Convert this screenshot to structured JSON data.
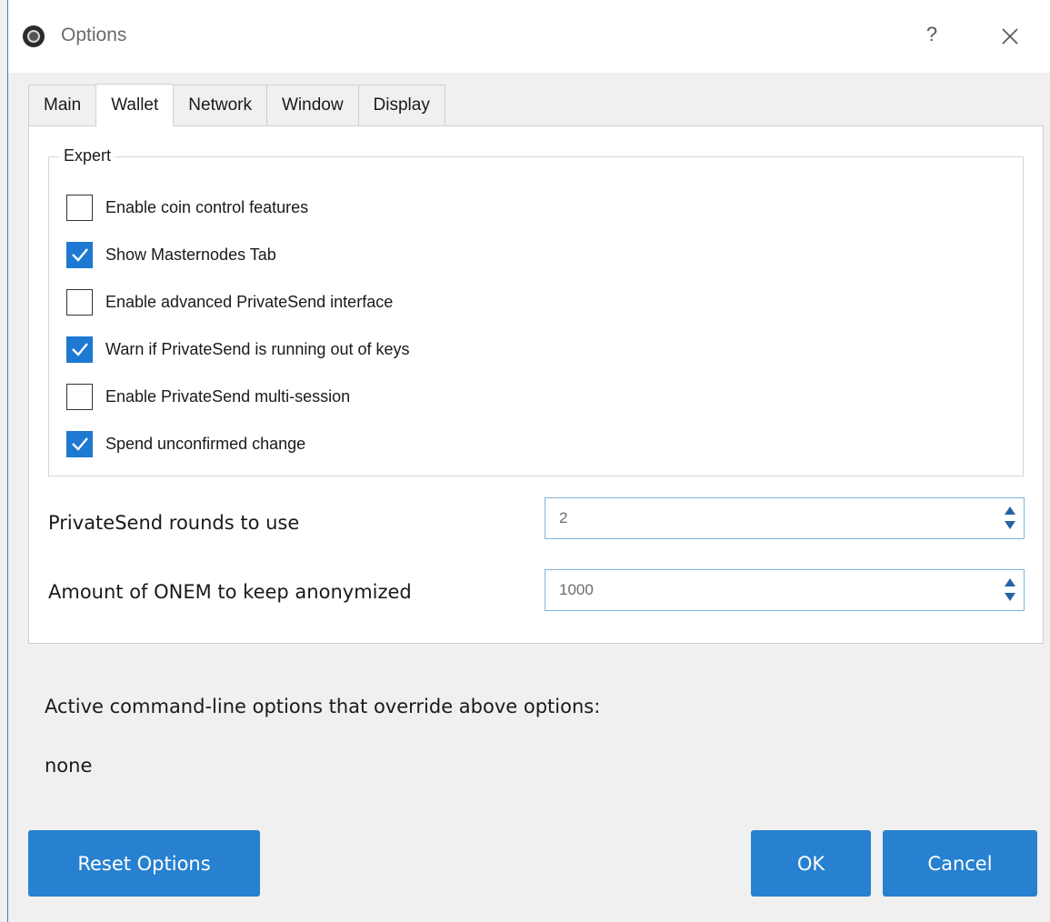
{
  "window": {
    "title": "Options",
    "help_label": "?",
    "icons": {
      "app": "app-logo-icon",
      "close": "close-icon"
    }
  },
  "tabs": [
    {
      "label": "Main",
      "active": false
    },
    {
      "label": "Wallet",
      "active": true
    },
    {
      "label": "Network",
      "active": false
    },
    {
      "label": "Window",
      "active": false
    },
    {
      "label": "Display",
      "active": false
    }
  ],
  "expert": {
    "title": "Expert",
    "options": [
      {
        "label": "Enable coin control features",
        "checked": false
      },
      {
        "label": "Show Masternodes Tab",
        "checked": true
      },
      {
        "label": "Enable advanced PrivateSend interface",
        "checked": false
      },
      {
        "label": "Warn if PrivateSend is running out of keys",
        "checked": true
      },
      {
        "label": "Enable PrivateSend multi-session",
        "checked": false
      },
      {
        "label": "Spend unconfirmed change",
        "checked": true
      }
    ]
  },
  "fields": {
    "rounds": {
      "label": "PrivateSend rounds to use",
      "value": "2"
    },
    "amount": {
      "label": "Amount of ONEM to keep anonymized",
      "value": "1000"
    }
  },
  "cmdline": {
    "label": "Active command-line options that override above options:",
    "value": "none"
  },
  "buttons": {
    "reset": "Reset Options",
    "ok": "OK",
    "cancel": "Cancel"
  },
  "colors": {
    "accent": "#2781d0",
    "checkbox_checked": "#1d79d1",
    "spin_border": "#7fb3df"
  }
}
